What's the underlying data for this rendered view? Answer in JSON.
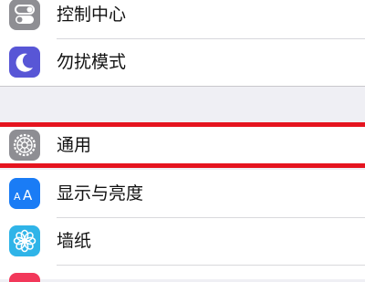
{
  "settings": {
    "group1": [
      {
        "label": "控制中心",
        "icon": "control-center-icon",
        "icon_color": "#8e8e93"
      },
      {
        "label": "勿扰模式",
        "icon": "moon-icon",
        "icon_color": "#5856d6"
      }
    ],
    "general": {
      "label": "通用",
      "icon": "gear-icon",
      "icon_color": "#8e8e93",
      "highlighted": true,
      "highlight_color": "#e5141f"
    },
    "group2": [
      {
        "label": "显示与亮度",
        "icon": "display-brightness-icon",
        "icon_color": "#1a7cf5"
      },
      {
        "label": "墙纸",
        "icon": "wallpaper-flower-icon",
        "icon_color": "#2fb4e8"
      }
    ],
    "next_icon_color": "#f2385a"
  }
}
